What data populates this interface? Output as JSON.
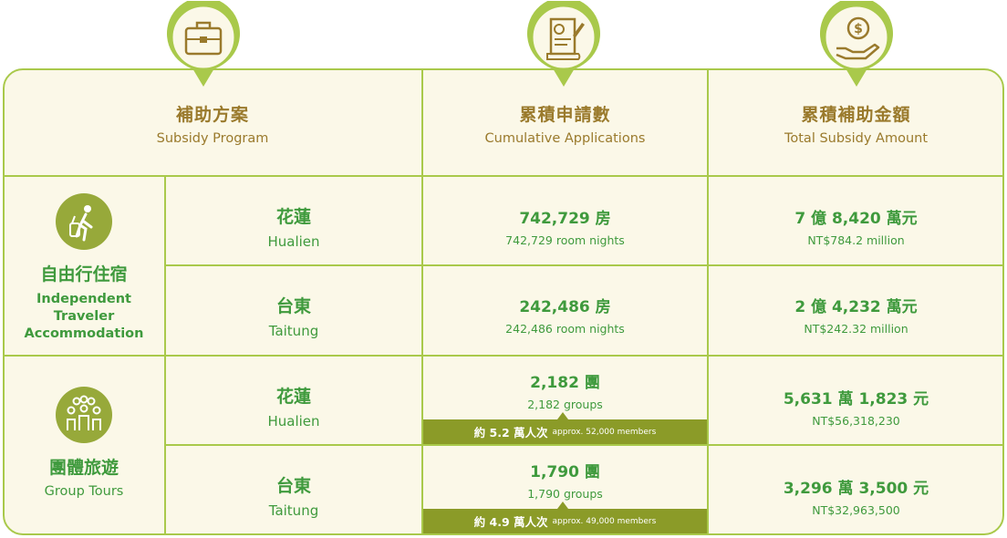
{
  "headers": {
    "program": {
      "zh": "補助方案",
      "en": "Subsidy Program",
      "icon": "luggage-icon"
    },
    "applications": {
      "zh": "累積申請數",
      "en": "Cumulative Applications",
      "icon": "document-sign-icon"
    },
    "amount": {
      "zh": "累積補助金額",
      "en": "Total Subsidy Amount",
      "icon": "money-hand-icon"
    }
  },
  "categories": [
    {
      "zh": "自由行住宿",
      "en_lines": [
        "Independent",
        "Traveler",
        "Accommodation"
      ],
      "icon": "traveler-icon"
    },
    {
      "zh": "團體旅遊",
      "en": "Group Tours",
      "icon": "group-people-icon"
    }
  ],
  "rows": [
    {
      "city_zh": "花蓮",
      "city_en": "Hualien",
      "apps_big": "742,729 房",
      "apps_small": "742,729 room nights",
      "amount_big": "7 億 8,420 萬元",
      "amount_small": "NT$784.2 million"
    },
    {
      "city_zh": "台東",
      "city_en": "Taitung",
      "apps_big": "242,486 房",
      "apps_small": "242,486 room nights",
      "amount_big": "2 億 4,232 萬元",
      "amount_small": "NT$242.32 million"
    },
    {
      "city_zh": "花蓮",
      "city_en": "Hualien",
      "apps_big": "2,182 團",
      "apps_small": "2,182 groups",
      "band_main": "約 5.2 萬人次",
      "band_small": "approx. 52,000 members",
      "amount_big": "5,631 萬 1,823 元",
      "amount_small": "NT$56,318,230"
    },
    {
      "city_zh": "台東",
      "city_en": "Taitung",
      "apps_big": "1,790 團",
      "apps_small": "1,790 groups",
      "band_main": "約 4.9 萬人次",
      "band_small": "approx. 49,000  members",
      "amount_big": "3,296 萬 3,500 元",
      "amount_small": "NT$32,963,500"
    }
  ],
  "colors": {
    "green_text": "#3f9a3d",
    "gold_text": "#9a7a2c",
    "border": "#a9c94b",
    "band": "#8b9b28",
    "background": "#fbf8e8"
  }
}
